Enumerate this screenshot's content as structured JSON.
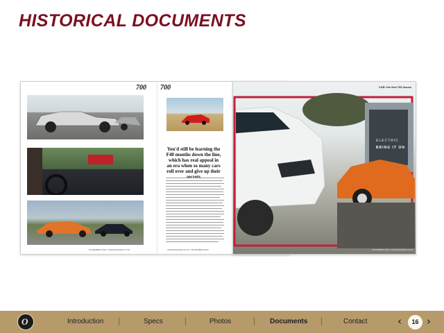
{
  "slide": {
    "title": "HISTORICAL DOCUMENTS",
    "page_number": "16"
  },
  "magazine": {
    "logo": "700",
    "left_spread": {
      "headline": "You'd still be learning the F40 months down the line, which has real appeal in an era when so many cars roll over and give up their secrets",
      "folio_left": "NOVEMBER 2020 | CARMAGAZINE.CO.UK",
      "folio_right": "CARMAGAZINE.CO.UK | NOVEMBER 2020"
    },
    "right_spread": {
      "header": "CAR: the first 700 issues",
      "feature_line1": "ELECTRIC",
      "feature_line2": "BRING IT ON",
      "folio": "NOVEMBER 2020 | CARMAGAZINE.CO.UK"
    }
  },
  "nav": {
    "items": [
      {
        "label": "Introduction"
      },
      {
        "label": "Specs"
      },
      {
        "label": "Photos"
      },
      {
        "label": "Documents"
      },
      {
        "label": "Contact"
      }
    ],
    "active": "Documents",
    "prev_icon": "chevron-left-icon",
    "next_icon": "chevron-right-icon"
  },
  "colors": {
    "title": "#7a1020",
    "nav_bar": "#b69a6a",
    "accent_red": "#c0203a"
  }
}
